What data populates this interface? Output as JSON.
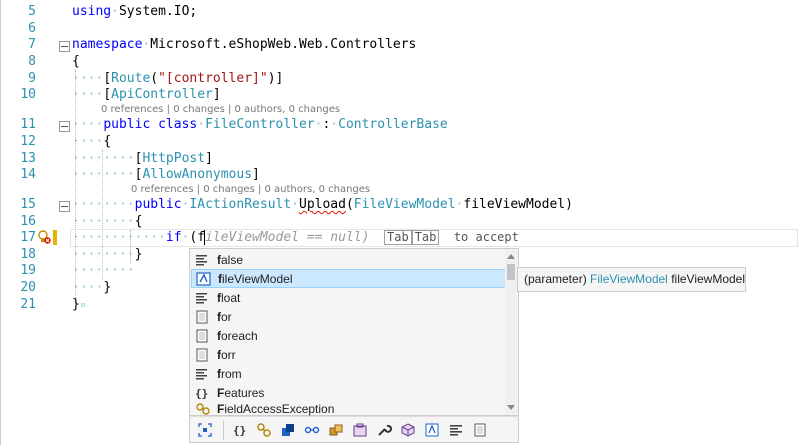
{
  "editor": {
    "lines": [
      {
        "n": "5"
      },
      {
        "n": "6"
      },
      {
        "n": "7"
      },
      {
        "n": "8"
      },
      {
        "n": "9"
      },
      {
        "n": "10"
      },
      {
        "n": "11"
      },
      {
        "n": "12"
      },
      {
        "n": "13"
      },
      {
        "n": "14"
      },
      {
        "n": "15"
      },
      {
        "n": "16"
      },
      {
        "n": "17"
      },
      {
        "n": "18"
      },
      {
        "n": "19"
      },
      {
        "n": "20"
      },
      {
        "n": "21"
      }
    ],
    "code": {
      "l5_kw": "using",
      "l5_rest": "System.IO;",
      "l7_kw": "namespace",
      "l7_rest": "Microsoft.eShopWeb.Web.Controllers",
      "l8": "{",
      "l9_open": "[",
      "l9_attr": "Route",
      "l9_str": "\"[controller]\"",
      "l9_close": ")]",
      "l9_paren": "(",
      "l10_open": "[",
      "l10_attr": "ApiController",
      "l10_close": "]",
      "lens_10": "0 references | 0 changes | 0 authors, 0 changes",
      "l11_kw": "public class",
      "l11_name": "FileController",
      "l11_colon": ":",
      "l11_base": "ControllerBase",
      "l12": "{",
      "l13_open": "[",
      "l13_attr": "HttpPost",
      "l13_close": "]",
      "l14_open": "[",
      "l14_attr": "AllowAnonymous",
      "l14_close": "]",
      "lens_14": "0 references | 0 changes | 0 authors, 0 changes",
      "l15_kw": "public",
      "l15_type": "IActionResult",
      "l15_method": "Upload",
      "l15_paren_open": "(",
      "l15_ptype": "FileViewModel",
      "l15_pname": "fileViewModel)",
      "l16": "{",
      "l17_kw": "if",
      "l17_open": "(",
      "l17_typed": "f",
      "l17_ghost": "ileViewModel == null)",
      "l17_tab1": "Tab",
      "l17_tab2": "Tab",
      "l17_hint": "to accept",
      "l18": "}",
      "l20": "}",
      "l21": "}"
    }
  },
  "completion": {
    "items": [
      {
        "bold": "f",
        "rest": "alse",
        "icon": "keyword-icon"
      },
      {
        "bold": "f",
        "rest": "ileViewModel",
        "icon": "parameter-icon",
        "selected": true
      },
      {
        "bold": "f",
        "rest": "loat",
        "icon": "keyword-icon"
      },
      {
        "bold": "f",
        "rest": "or",
        "icon": "snippet-icon"
      },
      {
        "bold": "f",
        "rest": "oreach",
        "icon": "snippet-icon"
      },
      {
        "bold": "f",
        "rest": "orr",
        "icon": "snippet-icon"
      },
      {
        "bold": "f",
        "rest": "rom",
        "icon": "keyword-icon"
      },
      {
        "bold": "F",
        "rest": "eatures",
        "icon": "namespace-icon"
      },
      {
        "bold": "F",
        "rest": "ieldAccessException",
        "icon": "class-icon"
      }
    ],
    "tooltip": {
      "prefix": "(parameter)",
      "type": "FileViewModel",
      "name": "fileViewModel"
    },
    "filters": [
      "expander-icon",
      "namespace-filter-icon",
      "class-filter-icon",
      "struct-filter-icon",
      "interface-filter-icon",
      "enum-filter-icon",
      "module-filter-icon",
      "property-filter-icon",
      "method-filter-icon",
      "field-filter-icon",
      "snippet-filter-icon",
      "keyword-filter-icon"
    ]
  }
}
